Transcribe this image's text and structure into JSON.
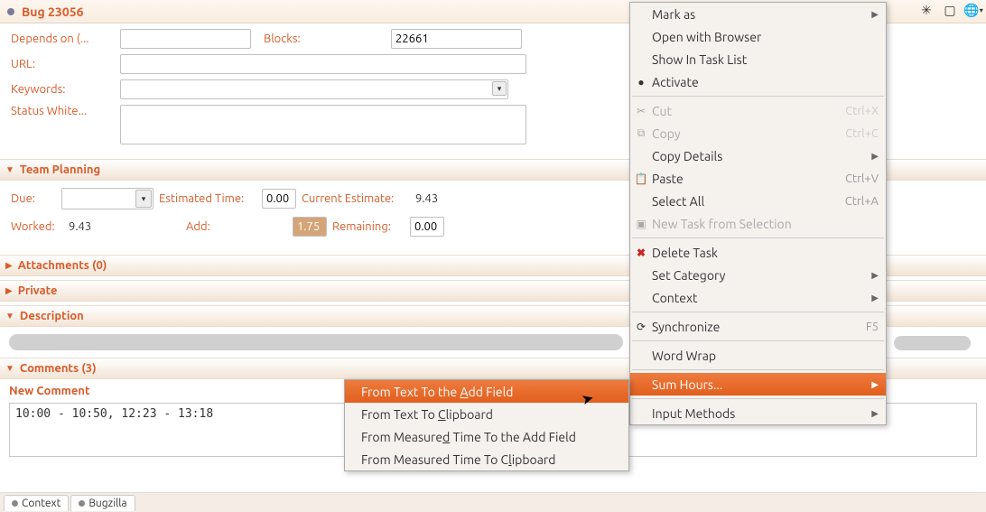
{
  "header": {
    "title": "Bug 23056"
  },
  "form": {
    "depends_label": "Depends on (...",
    "depends_value": "",
    "blocks_label": "Blocks:",
    "blocks_value": "22661",
    "url_label": "URL:",
    "url_value": "",
    "keywords_label": "Keywords:",
    "keywords_value": "",
    "status_label": "Status White...",
    "status_value": ""
  },
  "sections": {
    "team_planning": "Team Planning",
    "attachments": "Attachments (0)",
    "private": "Private",
    "description": "Description",
    "comments": "Comments (3)"
  },
  "planning": {
    "due_label": "Due:",
    "due_value": "",
    "est_label": "Estimated Time:",
    "est_value": "0.00",
    "cur_label": "Current Estimate:",
    "cur_value": "9.43",
    "worked_label": "Worked:",
    "worked_value": "9.43",
    "add_label": "Add:",
    "add_value": "1.75",
    "rem_label": "Remaining:",
    "rem_value": "0.00"
  },
  "comment": {
    "new_label": "New Comment",
    "text": "10:00 - 10:50, 12:23 - 13:18"
  },
  "footer": {
    "tab1": "Context",
    "tab2": "Bugzilla"
  },
  "menu_main": {
    "mark_as": "Mark as",
    "open_browser": "Open with Browser",
    "show_task_list": "Show In Task List",
    "activate": "Activate",
    "cut": "Cut",
    "cut_k": "Ctrl+X",
    "copy": "Copy",
    "copy_k": "Ctrl+C",
    "copy_details": "Copy Details",
    "paste": "Paste",
    "paste_k": "Ctrl+V",
    "select_all": "Select All",
    "select_all_k": "Ctrl+A",
    "new_task": "New Task from Selection",
    "delete_task": "Delete Task",
    "set_category": "Set Category",
    "context": "Context",
    "synchronize": "Synchronize",
    "sync_k": "F5",
    "word_wrap": "Word Wrap",
    "sum_hours": "Sum Hours...",
    "input_methods": "Input Methods"
  },
  "menu_sub": {
    "to_add": "From Text To the Add Field",
    "to_clip": "From Text To Clipboard",
    "measured_add": "From Measured Time To the Add Field",
    "measured_clip": "From Measured Time To Clipboard"
  }
}
